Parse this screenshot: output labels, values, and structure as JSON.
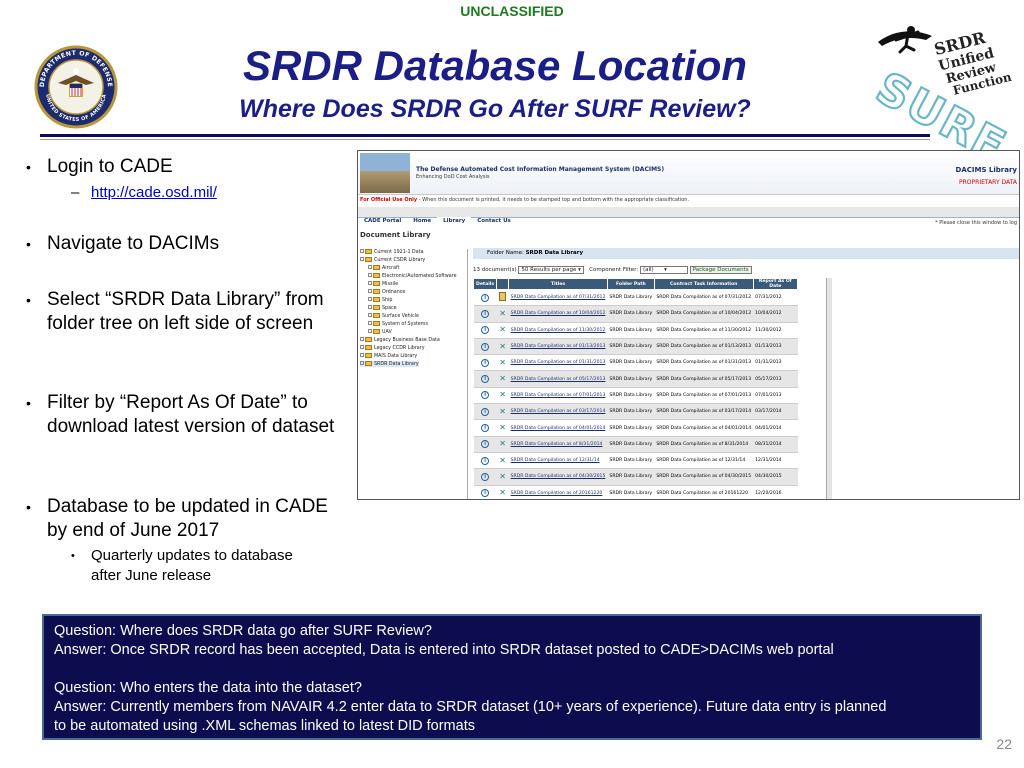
{
  "classification": "UNCLASSIFIED",
  "title": "SRDR Database Location",
  "subtitle": "Where Does SRDR Go After SURF Review?",
  "logos": {
    "seal_lines": [
      "DEPARTMENT OF DEFENSE",
      "UNITED STATES OF AMERICA"
    ],
    "surf_lines": [
      "SRDR",
      "Unified",
      "Review",
      "Function",
      "SURF"
    ]
  },
  "bullets": [
    {
      "text": "Login to CADE",
      "sub": [
        {
          "text": "http://cade.osd.mil/",
          "marker": "–",
          "is_link": true
        }
      ]
    },
    {
      "text": "Navigate to DACIMs"
    },
    {
      "text": "Select “SRDR Data Library” from folder tree on left side of screen"
    },
    {
      "text": "Filter by “Report As Of Date” to download latest version of dataset"
    },
    {
      "text": "Database to be updated in CADE by end of June 2017",
      "sub": [
        {
          "text": "Quarterly updates to database after June release",
          "marker": "•"
        }
      ]
    }
  ],
  "screenshot": {
    "header_title": "The Defense Automated Cost Information Management System (DACIMS)",
    "header_tagline": "Enhancing DoD Cost Analysis",
    "library_title": "DACIMS Library",
    "proprietary": "PROPRIETARY DATA",
    "warning_bold": "For Official Use Only",
    "warning_rest": " - When this document is printed, it needs to be stamped top and bottom with the appropriate classification.",
    "nav_tabs": [
      "CADE Portal",
      "Home",
      "Library",
      "Contact Us"
    ],
    "close_note": "* Please close this window to log",
    "doc_library": "Document Library",
    "tree": [
      {
        "label": "Current 1921-1 Data",
        "level": 0
      },
      {
        "label": "Current CSDR Library",
        "level": 0
      },
      {
        "label": "Aircraft",
        "level": 1
      },
      {
        "label": "Electronic/Automated Software",
        "level": 1
      },
      {
        "label": "Missile",
        "level": 1
      },
      {
        "label": "Ordnance",
        "level": 1
      },
      {
        "label": "Ship",
        "level": 1
      },
      {
        "label": "Space",
        "level": 1
      },
      {
        "label": "Surface Vehicle",
        "level": 1
      },
      {
        "label": "System of Systems",
        "level": 1
      },
      {
        "label": "UAV",
        "level": 1
      },
      {
        "label": "Legacy Business Base Data",
        "level": 0
      },
      {
        "label": "Legacy CCDR Library",
        "level": 0
      },
      {
        "label": "MAIS Data Library",
        "level": 0
      },
      {
        "label": "SRDR Data Library",
        "level": 0,
        "selected": true
      }
    ],
    "folder_label": "Folder Name:",
    "folder_name": "SRDR Data Library",
    "doc_count": "13 document(s)",
    "per_page": "50 Results per page",
    "component_filter_label": "Component Filter:",
    "component_filter_value": "(all)",
    "package_button": "Package Documents",
    "columns": [
      "Details",
      "Titles",
      "Folder Path",
      "Contract Task Information",
      "Report As Of Date"
    ],
    "rows": [
      {
        "icon": "pkg",
        "title": "SRDR Data Compilation as of 07/31/2012",
        "path": "SRDR Data Library",
        "task": "SRDR Data Compilation as of 07/31/2012",
        "date": "07/31/2012"
      },
      {
        "icon": "dl",
        "title": "SRDR Data Compilation as of 10/04/2012",
        "path": "SRDR Data Library",
        "task": "SRDR Data Compilation as of 10/04/2012",
        "date": "10/04/2012"
      },
      {
        "icon": "dl",
        "title": "SRDR Data Compilation as of 11/30/2012",
        "path": "SRDR Data Library",
        "task": "SRDR Data Compilation as of 11/30/2012",
        "date": "11/30/2012"
      },
      {
        "icon": "dl",
        "title": "SRDR Data Compilation as of 01/13/2013",
        "path": "SRDR Data Library",
        "task": "SRDR Data Compilation as of 01/13/2013",
        "date": "01/13/2013"
      },
      {
        "icon": "dl",
        "title": "SRDR Data Compilation as of 01/31/2013",
        "path": "SRDR Data Library",
        "task": "SRDR Data Compilation as of 01/31/2013",
        "date": "01/31/2013"
      },
      {
        "icon": "dl",
        "title": "SRDR Data Compilation as of 05/17/2013",
        "path": "SRDR Data Library",
        "task": "SRDR Data Compilation as of 05/17/2013",
        "date": "05/17/2013"
      },
      {
        "icon": "dl",
        "title": "SRDR Data Compilation as of 07/01/2013",
        "path": "SRDR Data Library",
        "task": "SRDR Data Compilation as of 07/01/2013",
        "date": "07/01/2013"
      },
      {
        "icon": "dl",
        "title": "SRDR Data Compilation as of 03/17/2014",
        "path": "SRDR Data Library",
        "task": "SRDR Data Compilation as of 03/17/2014",
        "date": "03/17/2014"
      },
      {
        "icon": "dl",
        "title": "SRDR Data Compilation as of 04/01/2014",
        "path": "SRDR Data Library",
        "task": "SRDR Data Compilation as of 04/01/2014",
        "date": "04/01/2014"
      },
      {
        "icon": "dl",
        "title": "SRDR Data Compilation as of 8/31/2014",
        "path": "SRDR Data Library",
        "task": "SRDR Data Compilation as of 8/31/2014",
        "date": "08/31/2014"
      },
      {
        "icon": "dl",
        "title": "SRDR Data Compilation as of 12/31/14",
        "path": "SRDR Data Library",
        "task": "SRDR Data Compilation as of 12/31/14",
        "date": "12/31/2014"
      },
      {
        "icon": "dl",
        "title": "SRDR Data Compilation as of 04/30/2015",
        "path": "SRDR Data Library",
        "task": "SRDR Data Compilation as of 04/30/2015",
        "date": "04/30/2015"
      },
      {
        "icon": "dl",
        "title": "SRDR Data Compilation as of 20161220",
        "path": "SRDR Data Library",
        "task": "SRDR Data Compilation as of 20161220",
        "date": "12/20/2016"
      }
    ]
  },
  "qa": {
    "lines": [
      "Question: Where does SRDR data go after SURF Review?",
      "Answer: Once SRDR record has been accepted, Data is entered into SRDR dataset posted to CADE>DACIMs web portal",
      "",
      "Question: Who enters the data into the dataset?",
      "Answer: Currently members from NAVAIR 4.2 enter data to SRDR dataset (10+ years of experience). Future data entry is planned",
      "to be automated using .XML schemas linked to latest DID formats"
    ]
  },
  "page_number": "22",
  "colors": {
    "title": "#1b1f85",
    "classification": "#1f7a1f",
    "qa_background": "#0c0c4e"
  }
}
